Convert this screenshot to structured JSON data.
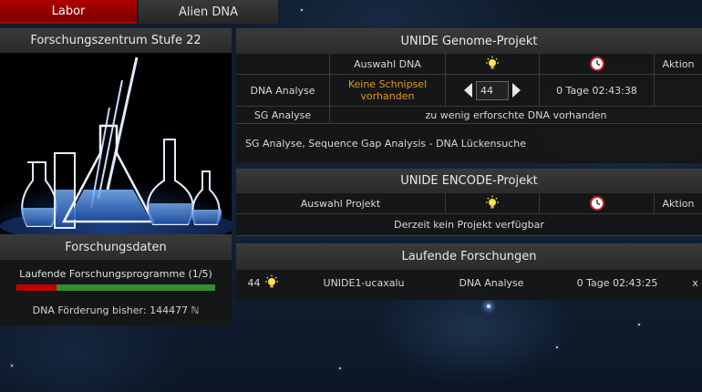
{
  "tabs": {
    "labor": "Labor",
    "alien": "Alien DNA"
  },
  "research_center": {
    "title": "Forschungszentrum Stufe 22"
  },
  "research_data": {
    "title": "Forschungsdaten",
    "programs_label": "Laufende Forschungsprogramme (1/5)",
    "programs_progress": 0.2,
    "funding_label": "DNA Förderung bisher: 144477 ℕ"
  },
  "genome": {
    "title": "UNIDE Genome-Projekt",
    "col_select": "Auswahl DNA",
    "col_action": "Aktion",
    "dna_label": "DNA Analyse",
    "dna_status": "Keine Schnipsel vorhanden",
    "qty": "44",
    "dna_time": "0 Tage 02:43:38",
    "sg_label": "SG Analyse",
    "sg_status": "zu wenig erforschte DNA vorhanden",
    "note": "SG Analyse, Sequence Gap Analysis - DNA Lückensuche"
  },
  "encode": {
    "title": "UNIDE ENCODE-Projekt",
    "col_select": "Auswahl Projekt",
    "col_action": "Aktion",
    "empty": "Derzeit kein Projekt verfügbar"
  },
  "running": {
    "title": "Laufende Forschungen",
    "items": [
      {
        "count": "44",
        "name": "UNIDE1-ucaxalu",
        "type": "DNA Analyse",
        "time": "0 Tage 02:43:25",
        "cancel": "x"
      }
    ]
  },
  "colors": {
    "accent_red": "#b00000",
    "highlight_orange": "#e49a14",
    "progress_green": "#2f8f2f"
  }
}
